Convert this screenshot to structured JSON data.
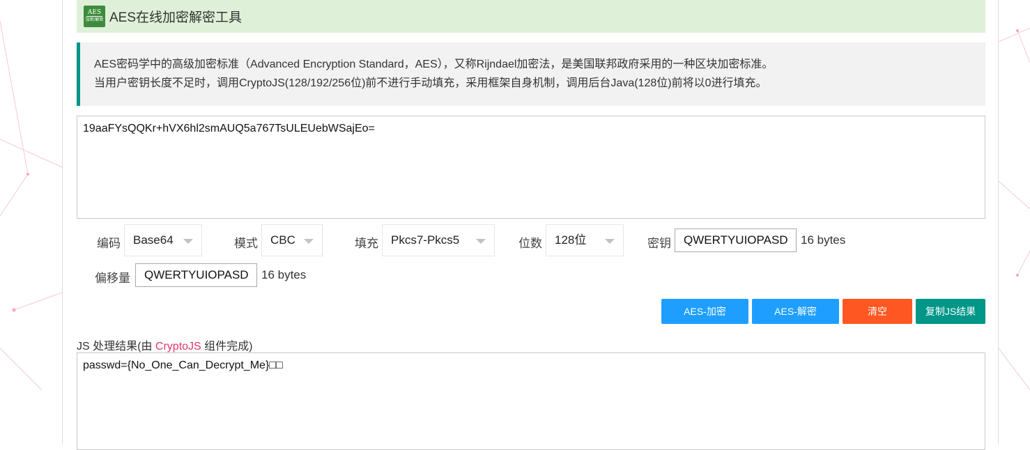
{
  "header": {
    "logo_line1": "AES",
    "logo_line2": "加密/解密",
    "title": "AES在线加密解密工具"
  },
  "description": {
    "line1": "AES密码学中的高级加密标准（Advanced Encryption Standard，AES），又称Rijndael加密法，是美国联邦政府采用的一种区块加密标准。",
    "line2": "当用户密钥长度不足时，调用CryptoJS(128/192/256位)前不进行手动填充，采用框架自身机制，调用后台Java(128位)前将以0进行填充。"
  },
  "input": {
    "value": "19aaFYsQQKr+hVX6hl2smAUQ5a767TsULEUebWSajEo="
  },
  "options": {
    "encoding": {
      "label": "编码",
      "value": "Base64"
    },
    "mode": {
      "label": "模式",
      "value": "CBC"
    },
    "padding": {
      "label": "填充",
      "value": "Pkcs7-Pkcs5"
    },
    "bits": {
      "label": "位数",
      "value": "128位"
    },
    "key": {
      "label": "密钥",
      "value": "QWERTYUIOPASDFGH",
      "bytes": "16 bytes"
    },
    "iv": {
      "label": "偏移量",
      "value": "QWERTYUIOPASDFGH",
      "bytes": "16 bytes"
    }
  },
  "buttons": {
    "encrypt": "AES-加密",
    "decrypt": "AES-解密",
    "clear": "清空",
    "copy": "复制JS结果"
  },
  "result": {
    "label_prefix": "JS 处理结果(由 ",
    "label_highlight": "CryptoJS",
    "label_suffix": " 组件完成)",
    "value": "passwd={No_One_Can_Decrypt_Me}□□"
  },
  "colors": {
    "title_bg": "#dff0d8",
    "desc_border": "#009688",
    "blue_button": "#1e9fff",
    "orange_button": "#ff5722",
    "teal_button": "#009688",
    "highlight": "#e8346a"
  }
}
